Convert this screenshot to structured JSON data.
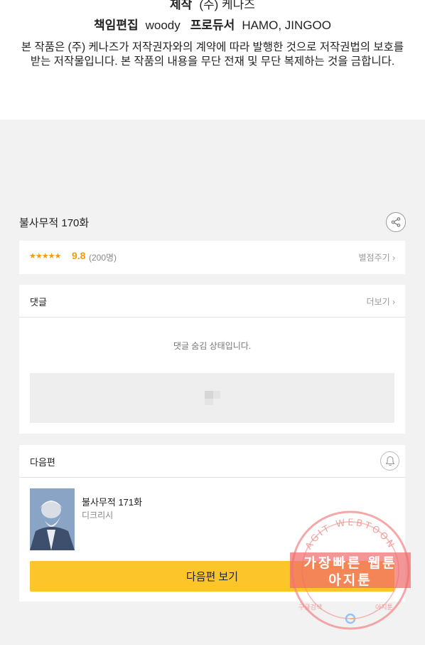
{
  "credits": {
    "line1_label": "제작",
    "line1_value": "(주) 케나즈",
    "line2_label1": "책임편집",
    "line2_value1": "woody",
    "line2_label2": "프로듀서",
    "line2_value2": "HAMO, JINGOO",
    "notice_line1": "본 작품은 (주) 케나즈가 저작권자와의 계약에 따라 발행한 것으로 저작권법의 보호를",
    "notice_line2": "받는 저작물입니다. 본 작품의 내용을 무단 전재 및 무단 복제하는 것을 금합니다."
  },
  "episode": {
    "title": "불사무적 170화",
    "share_icon": "share-icon"
  },
  "rating": {
    "stars": "★★★★★",
    "score": "9.8",
    "count": "(200명)",
    "rate_label": "별점주기"
  },
  "comments": {
    "label": "댓글",
    "more_label": "더보기",
    "hidden_message": "댓글 숨김 상태입니다."
  },
  "next": {
    "label": "다음편",
    "title": "불사무적 171화",
    "author": "디크리시",
    "button_label": "다음편 보기",
    "bell_icon": "bell-icon"
  },
  "watermark": {
    "arc_text": "AGIT WEBTOON",
    "line1": "가장빠른 웹툰",
    "line2": "아지툰",
    "bottom_left": "구글검색",
    "bottom_right": "아지툰"
  },
  "colors": {
    "accent_yellow": "#fcc52a",
    "star_orange": "#f29b0d",
    "background": "#f2f2f2"
  }
}
